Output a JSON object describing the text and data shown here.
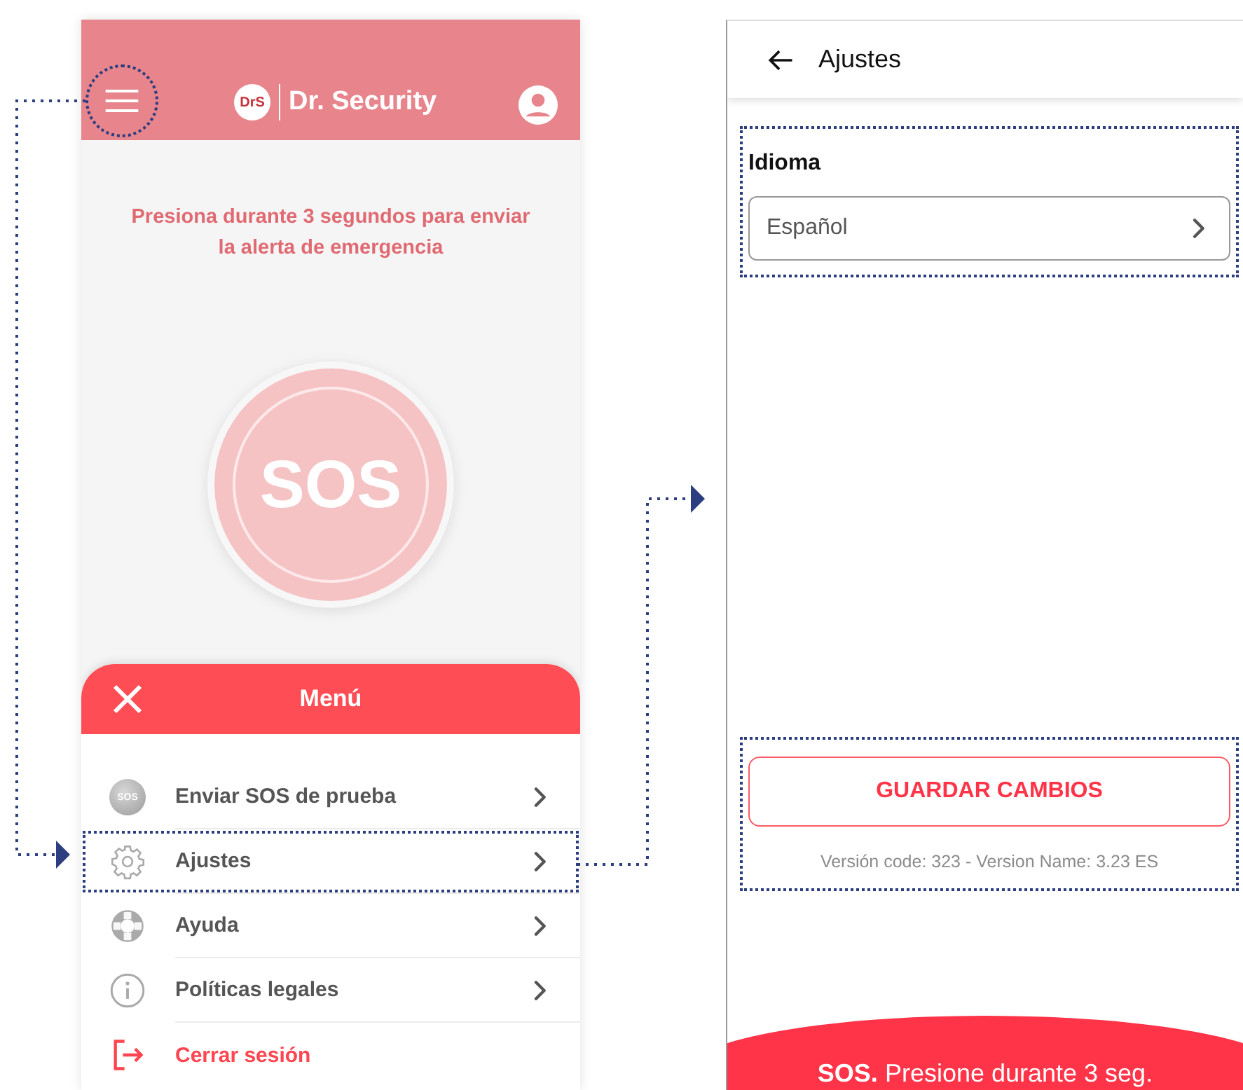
{
  "menu_screen": {
    "header": {
      "app_name": "Dr. Security",
      "logo_text": "DrS",
      "menu_button_highlighted": true
    },
    "instruction": "Presiona durante 3 segundos para enviar la alerta de emergencia",
    "sos_button": "SOS"
  },
  "menu": {
    "title": "Menú",
    "items": [
      {
        "kind": "sos",
        "icon_text": "SOS",
        "label": "Enviar SOS de prueba",
        "highlighted": false
      },
      {
        "kind": "settings",
        "label": "Ajustes",
        "highlighted": true
      },
      {
        "kind": "help",
        "label": "Ayuda",
        "highlighted": false
      },
      {
        "kind": "info",
        "label": "Políticas legales",
        "highlighted": false
      },
      {
        "kind": "logout",
        "label": "Cerrar sesión",
        "highlighted": false
      }
    ]
  },
  "settings_screen": {
    "title": "Ajustes",
    "language_section": {
      "label": "Idioma",
      "value": "Español",
      "highlighted": true
    },
    "footer_section": {
      "save_button": "GUARDAR CAMBIOS",
      "version": "Versión code: 323 - Version Name: 3.23 ES",
      "highlighted": true
    },
    "sos_bar": "**SOS.** Presione durante 3 seg."
  }
}
